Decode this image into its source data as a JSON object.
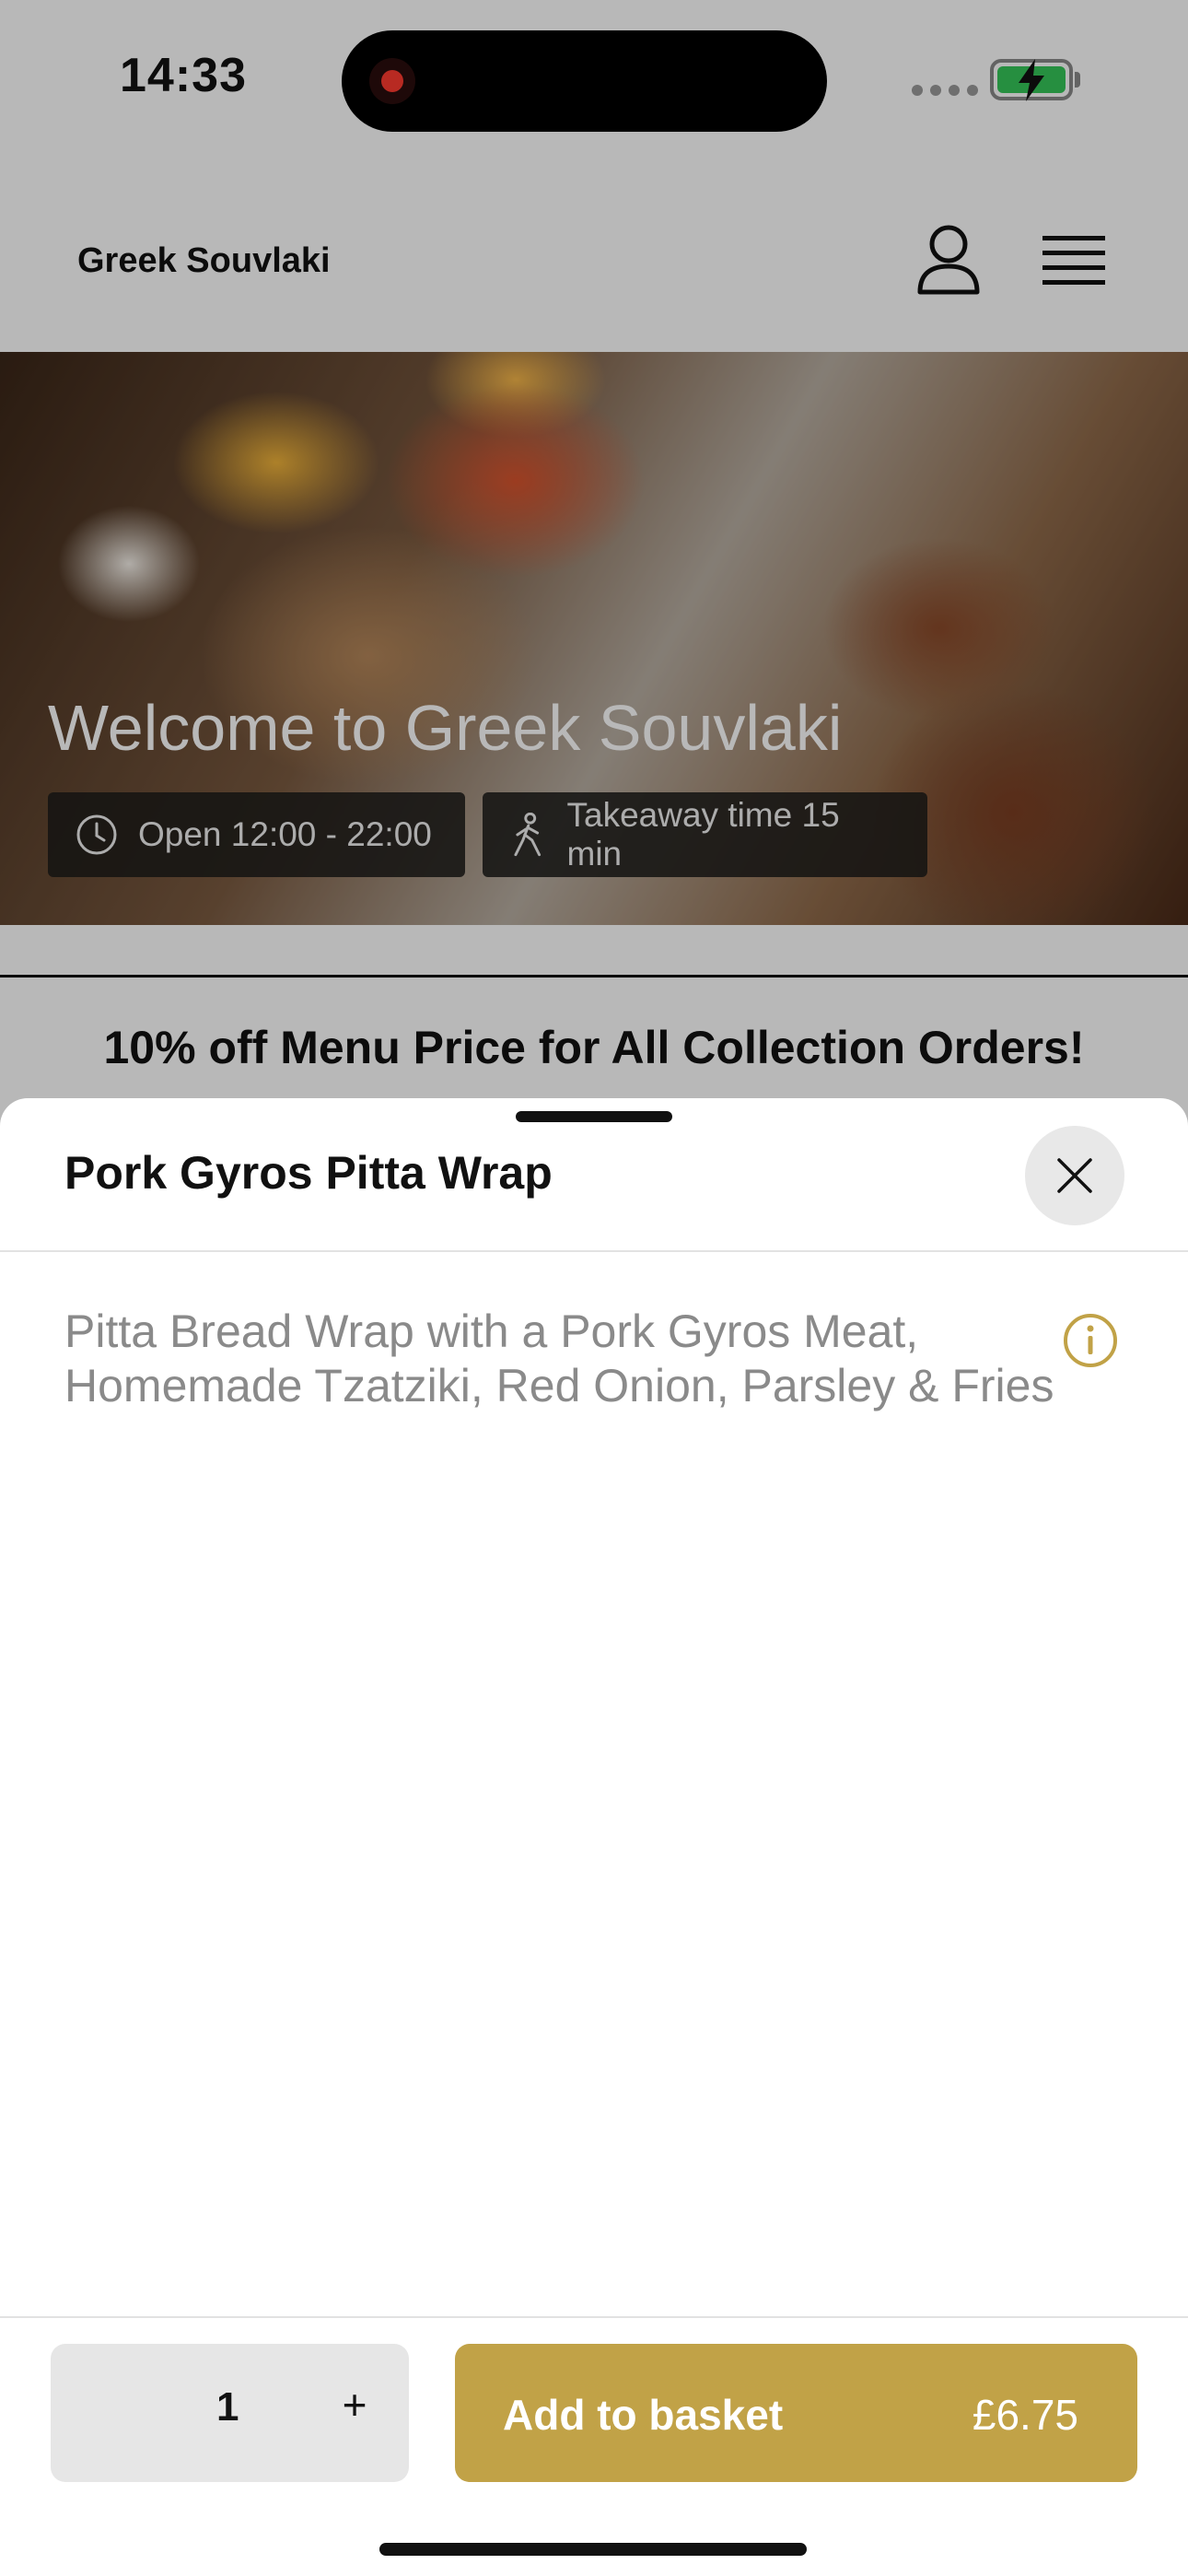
{
  "status_bar": {
    "time": "14:33",
    "signal_icon": "signal-dots-icon",
    "battery_icon": "battery-charging-icon",
    "battery_color": "#35c759",
    "record_color": "#ff3b30"
  },
  "header": {
    "brand": "Greek Souvlaki",
    "account_icon": "user-icon",
    "menu_icon": "hamburger-menu-icon"
  },
  "hero": {
    "title": "Welcome to Greek Souvlaki",
    "open_hours": "Open 12:00 - 22:00",
    "open_icon": "clock-icon",
    "takeaway": "Takeaway time 15 min",
    "takeaway_icon": "walking-icon"
  },
  "promo": {
    "text": "10% off Menu Price for All Collection Orders!"
  },
  "item_sheet": {
    "title": "Pork Gyros Pitta Wrap",
    "description": "Pitta Bread Wrap with a Pork Gyros Meat, Homemade Tzatziki, Red Onion, Parsley & Fries",
    "close_icon": "close-icon",
    "info_icon": "info-icon",
    "quantity": "1",
    "plus_label": "+",
    "add_label": "Add to basket",
    "price": "£6.75",
    "accent_color": "#c1a247"
  }
}
